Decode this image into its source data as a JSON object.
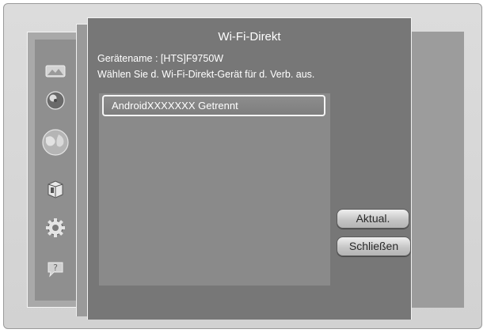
{
  "dialog": {
    "title": "Wi-Fi-Direkt",
    "device_name_line": "Gerätename : [HTS]F9750W",
    "instruction": "Wählen Sie d. Wi-Fi-Direkt-Gerät für d. Verb. aus."
  },
  "device_list": [
    {
      "label": "AndroidXXXXXXX Getrennt"
    }
  ],
  "buttons": {
    "refresh_label": "Aktual.",
    "close_label": "Schließen"
  },
  "sidebar": {
    "icons": [
      "picture-icon",
      "disc-icon",
      "globe-icon",
      "box-icon",
      "gear-icon",
      "help-icon"
    ]
  }
}
